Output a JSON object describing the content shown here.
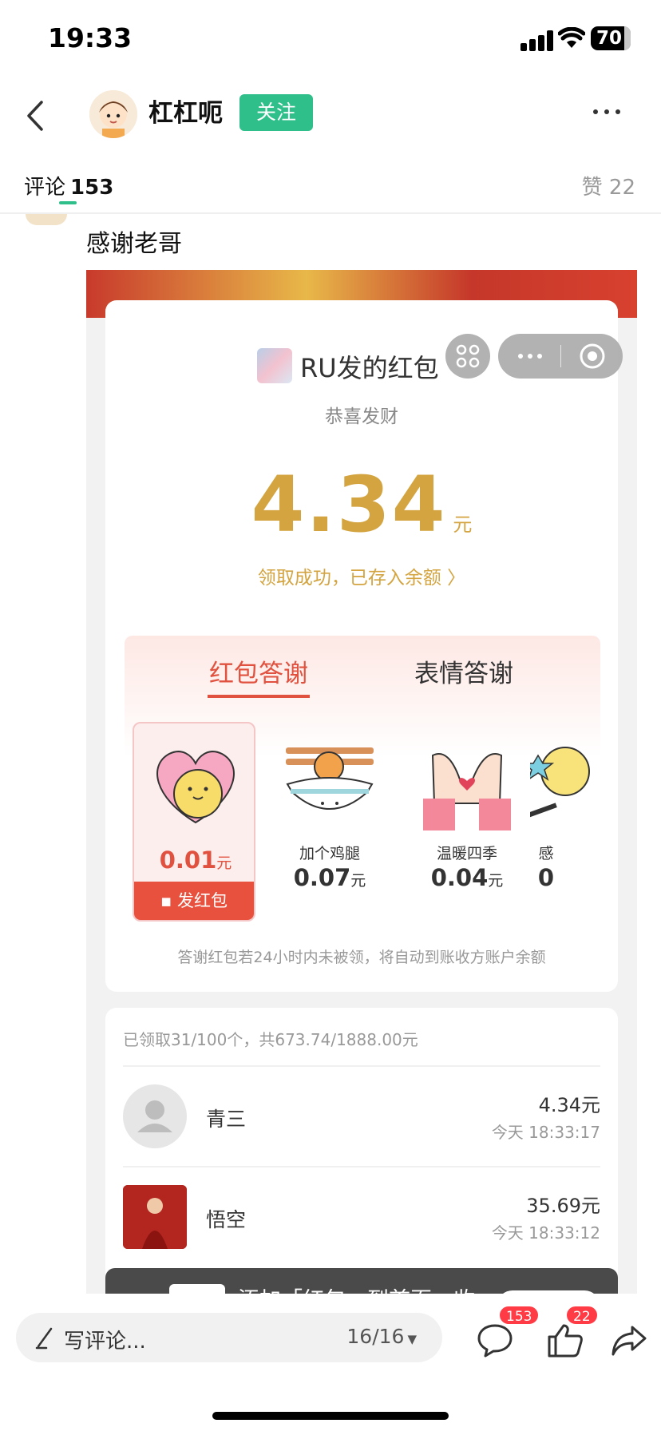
{
  "status": {
    "time": "19:33",
    "battery": "70"
  },
  "header": {
    "username": "杠杠呃",
    "follow_label": "关注"
  },
  "tabs": {
    "comments_label": "评论",
    "comments_count": "153",
    "likes_label": "赞 22"
  },
  "comment": {
    "text": "感谢老哥"
  },
  "redpacket": {
    "title": "RU发的红包",
    "subtitle": "恭喜发财",
    "amount": "4.34",
    "unit": "元",
    "success_text": "领取成功，已存入余额 〉",
    "tab_active": "红包答谢",
    "tab_other": "表情答谢",
    "gifts": [
      {
        "name": "",
        "price": "0.01",
        "unit": "元",
        "action": "发红包"
      },
      {
        "name": "加个鸡腿",
        "price": "0.07",
        "unit": "元"
      },
      {
        "name": "温暖四季",
        "price": "0.04",
        "unit": "元"
      },
      {
        "name": "感",
        "price": "0",
        "unit": ""
      }
    ],
    "note": "答谢红包若24小时内未被领，将自动到账收方账户余额",
    "summary": "已领取31/100个，共673.74/1888.00元",
    "records": [
      {
        "name": "青三",
        "amount": "4.34元",
        "time": "今天 18:33:17"
      },
      {
        "name": "悟空",
        "amount": "35.69元",
        "time": "今天 18:33:12"
      }
    ],
    "toast_text": "添加「红包」到首页，收"
  },
  "bottom": {
    "placeholder": "写评论...",
    "page_count": "16/16",
    "comment_badge": "153",
    "like_badge": "22"
  }
}
